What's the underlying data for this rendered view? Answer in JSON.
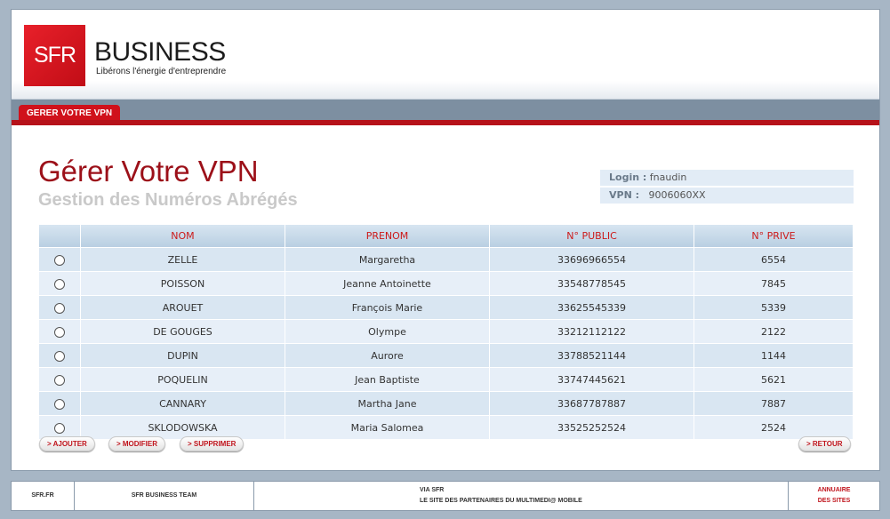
{
  "brand": {
    "logo_text": "SFR",
    "name": "BUSINESS",
    "tagline": "Libérons l'énergie d'entreprendre",
    "color": "#e8202a"
  },
  "nav": {
    "tab_label": "GERER VOTRE VPN"
  },
  "page": {
    "title": "Gérer Votre VPN",
    "subtitle": "Gestion des Numéros Abrégés"
  },
  "login": {
    "login_label": "Login :",
    "login_value": "fnaudin",
    "vpn_label": "VPN :",
    "vpn_value": "9006060XX"
  },
  "table": {
    "columns": [
      "NOM",
      "PRENOM",
      "N° PUBLIC",
      "N° PRIVE"
    ],
    "rows": [
      [
        "ZELLE",
        "Margaretha",
        "33696966554",
        "6554"
      ],
      [
        "POISSON",
        "Jeanne Antoinette",
        "33548778545",
        "7845"
      ],
      [
        "AROUET",
        "François Marie",
        "33625545339",
        "5339"
      ],
      [
        "DE GOUGES",
        "Olympe",
        "33212112122",
        "2122"
      ],
      [
        "DUPIN",
        "Aurore",
        "33788521144",
        "1144"
      ],
      [
        "POQUELIN",
        "Jean Baptiste",
        "33747445621",
        "5621"
      ],
      [
        "CANNARY",
        "Martha Jane",
        "33687787887",
        "7887"
      ],
      [
        "SKLODOWSKA",
        "Maria Salomea",
        "33525252524",
        "2524"
      ]
    ]
  },
  "actions": {
    "add": "> AJOUTER",
    "edit": "> MODIFIER",
    "delete": "> SUPPRIMER",
    "back": "> RETOUR"
  },
  "footer": {
    "sfr": "SFR.FR",
    "team": "SFR BUSINESS TEAM",
    "via_line1": "VIA SFR",
    "via_line2": "LE SITE DES PARTENAIRES DU MULTIMEDI@ MOBILE",
    "annuaire_line1": "ANNUAIRE",
    "annuaire_line2": "DES SITES"
  }
}
